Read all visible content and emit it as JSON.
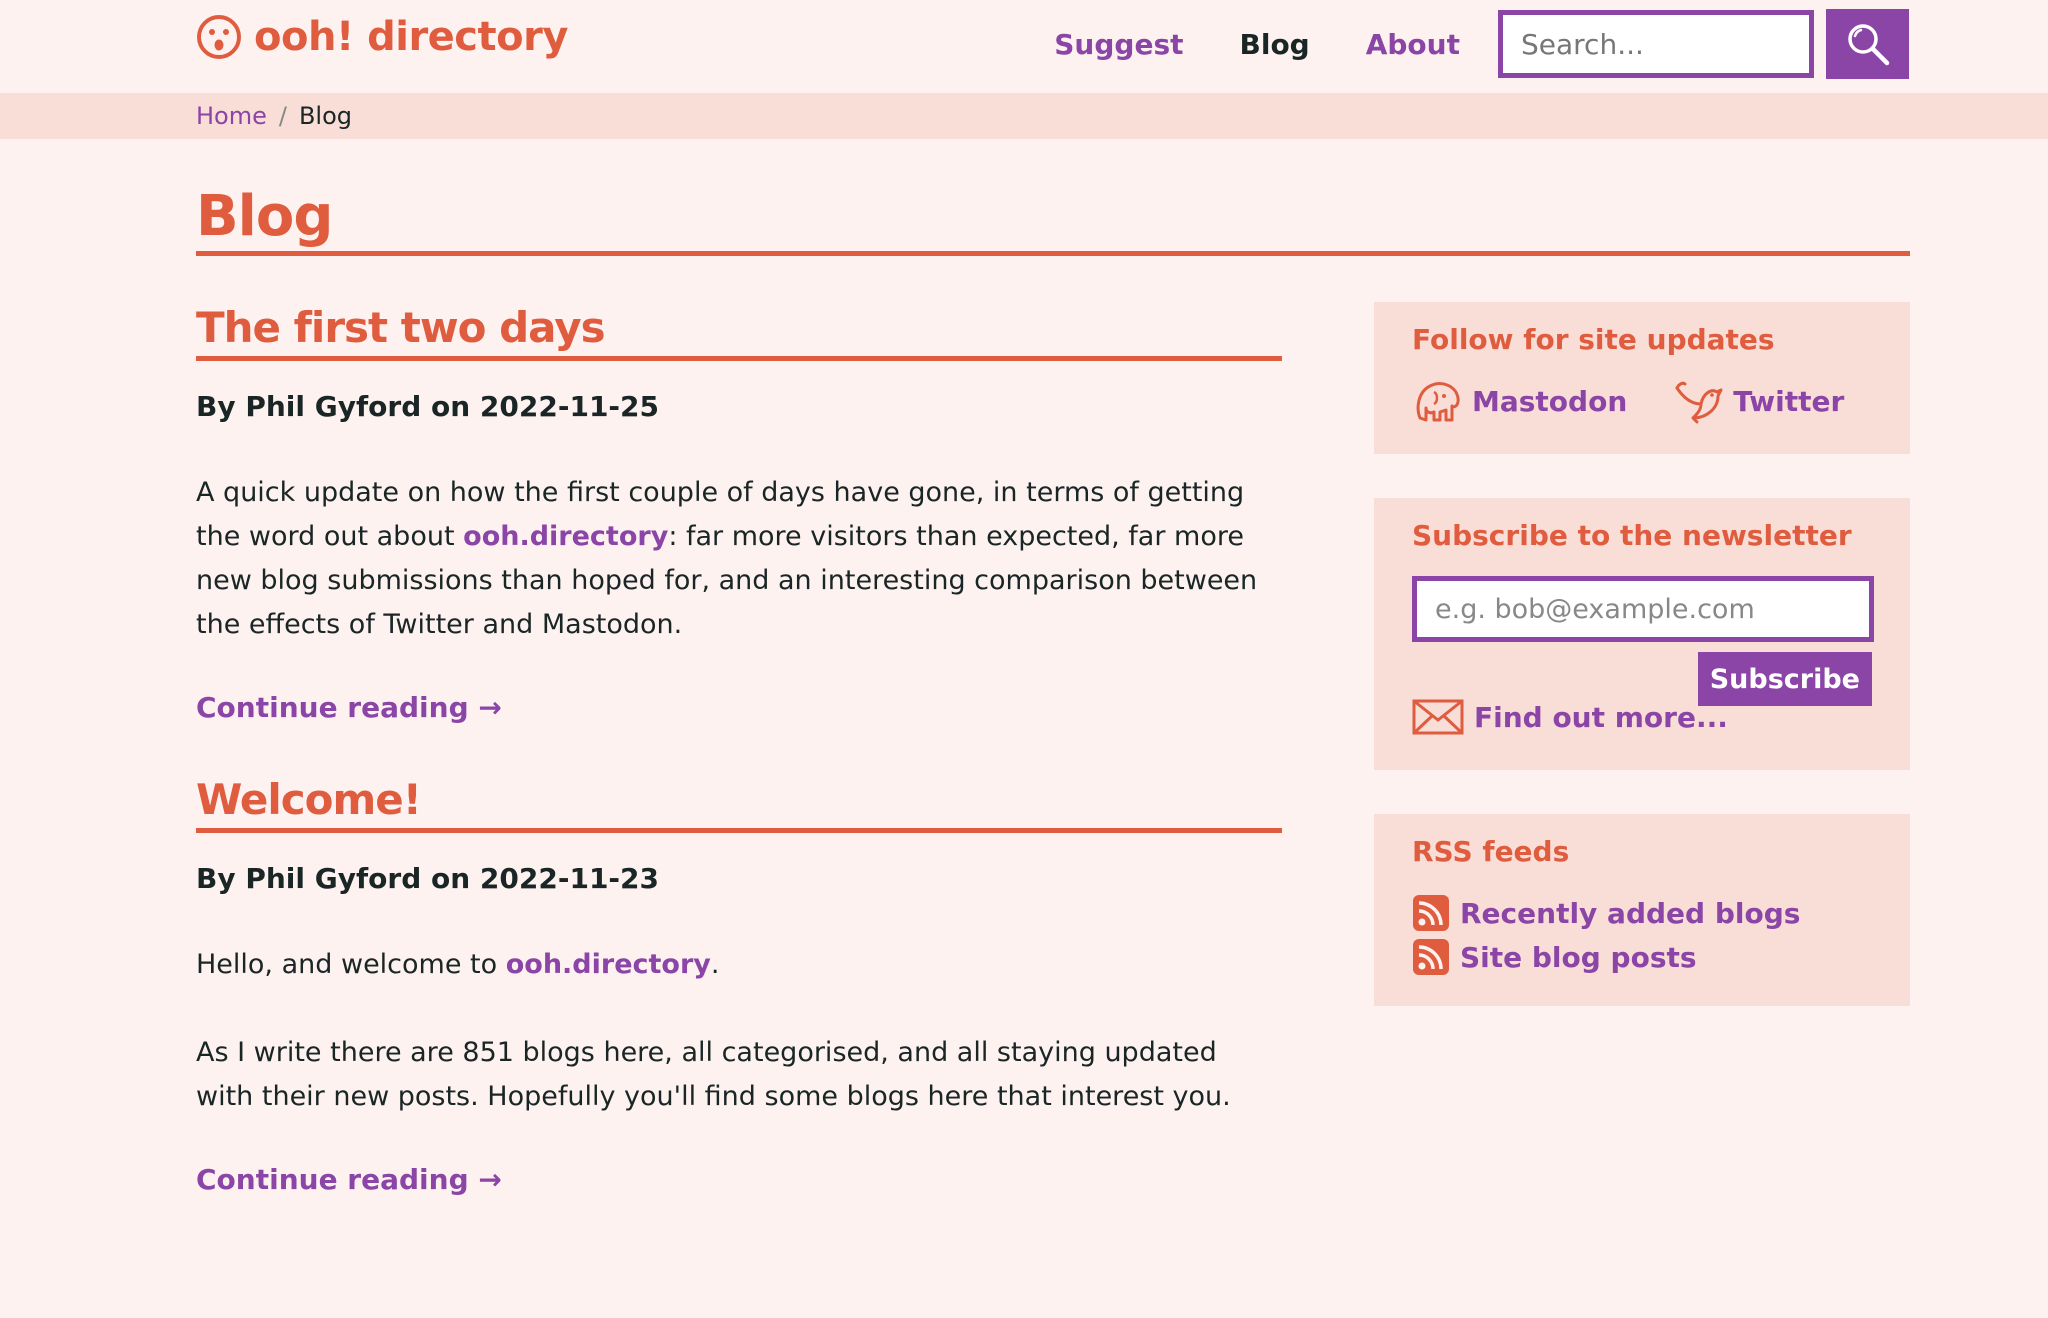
{
  "header": {
    "logo_text": "ooh! directory",
    "nav": [
      "Suggest",
      "Blog",
      "About"
    ],
    "current_nav": "Blog",
    "search_placeholder": "Search..."
  },
  "breadcrumb": {
    "home": "Home",
    "separator": "/",
    "current": "Blog"
  },
  "page_title": "Blog",
  "posts": [
    {
      "title": "The first two days",
      "byline": "By Phil Gyford on 2022-11-25",
      "paragraphs": [
        {
          "before": "A quick update on how the first couple of days have gone, in terms of getting the word out about ",
          "link": "ooh.directory",
          "after": ": far more visitors than expected, far more new blog submissions than hoped for, and an interesting comparison between the effects of Twitter and Mastodon."
        }
      ],
      "continue": "Continue reading →"
    },
    {
      "title": "Welcome!",
      "byline": "By Phil Gyford on 2022-11-23",
      "paragraphs": [
        {
          "before": "Hello, and welcome to ",
          "link": "ooh.directory",
          "after": "."
        },
        {
          "before": "As I write there are 851 blogs here, all categorised, and all staying updated with their new posts. Hopefully you'll find some blogs here that interest you.",
          "link": "",
          "after": ""
        }
      ],
      "continue": "Continue reading →"
    }
  ],
  "sidebar": {
    "follow": {
      "heading": "Follow for site updates",
      "mastodon": "Mastodon",
      "twitter": "Twitter"
    },
    "newsletter": {
      "heading": "Subscribe to the newsletter",
      "email_placeholder": "e.g. bob@example.com",
      "subscribe": "Subscribe",
      "find_out_more": "Find out more..."
    },
    "rss": {
      "heading": "RSS feeds",
      "items": [
        "Recently added blogs",
        "Site blog posts"
      ]
    }
  },
  "colors": {
    "accent": "#e05c3e",
    "link": "#8a45a6",
    "background": "#fdf2f0",
    "panel": "#f9ddd7"
  }
}
